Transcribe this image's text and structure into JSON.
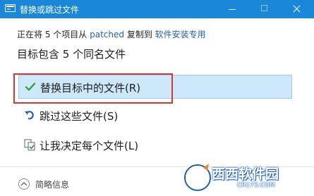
{
  "window": {
    "title": "替换或跳过文件",
    "accent_color": "#1a87d8"
  },
  "header": {
    "info_prefix": "正在将 5 个项目从",
    "source": "patched",
    "info_middle": "复制到",
    "destination": "软件安装专用",
    "heading": "目标包含 5 个同名文件"
  },
  "options": {
    "replace_label": "替换目标中的文件(R)",
    "skip_label": "跳过这些文件(S)",
    "decide_label": "让我决定每个文件(L)"
  },
  "footer": {
    "details_label": "简略信息"
  },
  "watermark": {
    "brand": "西西软件园",
    "site": "CR173.COM"
  }
}
